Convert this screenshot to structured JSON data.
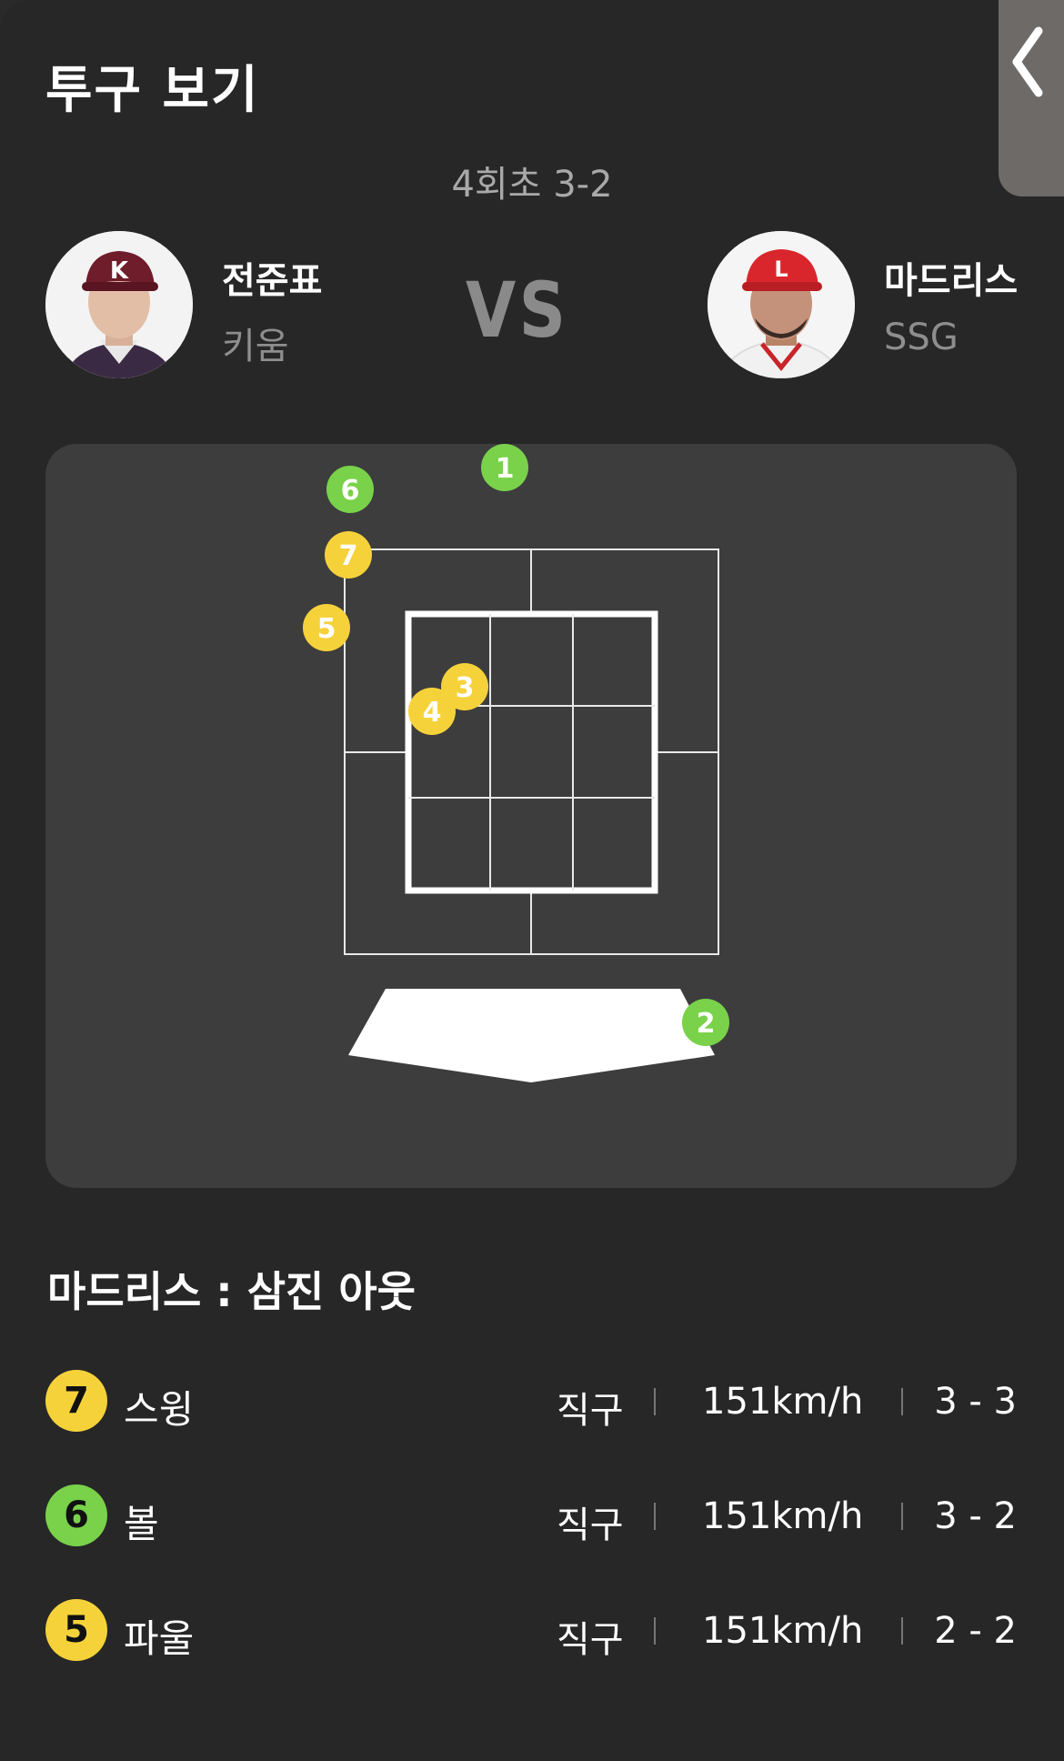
{
  "header": {
    "title": "투구 보기",
    "back_icon": "chevron-left-icon"
  },
  "game": {
    "inning": "4회초 3-2",
    "vs_label": "VS"
  },
  "pitcher": {
    "name": "전준표",
    "team": "키움",
    "cap_color": "#7a1f2e",
    "cap_letter": "K"
  },
  "batter": {
    "name": "마드리스",
    "team": "SSG",
    "cap_color": "#d9262c",
    "cap_letter": "L"
  },
  "zone": {
    "pitches": [
      {
        "num": "1",
        "kind": "ball"
      },
      {
        "num": "2",
        "kind": "ball"
      },
      {
        "num": "3",
        "kind": "strike"
      },
      {
        "num": "4",
        "kind": "strike"
      },
      {
        "num": "5",
        "kind": "strike"
      },
      {
        "num": "6",
        "kind": "ball"
      },
      {
        "num": "7",
        "kind": "strike"
      }
    ]
  },
  "colors": {
    "strike": "#f6d23a",
    "ball": "#79d24a",
    "panel": "#3d3d3d"
  },
  "result": "마드리스 : 삼진 아웃",
  "pitch_rows": [
    {
      "num": "7",
      "kind": "strike",
      "label": "스윙",
      "type": "직구",
      "speed": "151km/h",
      "count": "3 - 3"
    },
    {
      "num": "6",
      "kind": "ball",
      "label": "볼",
      "type": "직구",
      "speed": "151km/h",
      "count": "3 - 2"
    },
    {
      "num": "5",
      "kind": "strike",
      "label": "파울",
      "type": "직구",
      "speed": "151km/h",
      "count": "2 - 2"
    }
  ]
}
